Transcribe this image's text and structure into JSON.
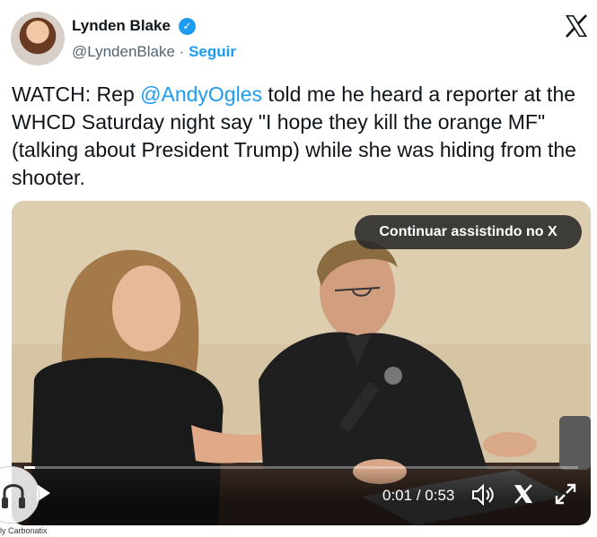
{
  "author": {
    "name": "Lynden Blake",
    "handle": "@LyndenBlake",
    "separator": "·",
    "follow_label": "Seguir",
    "verified_icon": "verified-badge-icon"
  },
  "header": {
    "logo_icon": "x-logo-icon"
  },
  "tweet": {
    "text_before": "WATCH: Rep ",
    "mention": "@AndyOgles",
    "text_after": " told me he heard a reporter at the WHCD Saturday night say \"I hope they kill the orange MF\" (talking about President Trump) while she was hiding from the shooter."
  },
  "video": {
    "continue_label": "Continuar assistindo no X",
    "time_current": "0:01",
    "time_separator": " / ",
    "time_total": "0:53",
    "progress_fraction": 0.02,
    "icons": [
      "play-icon",
      "volume-icon",
      "x-logo-icon",
      "fullscreen-icon"
    ]
  },
  "watermark": {
    "text": "ly Carbonatix",
    "icon": "headphones-icon"
  },
  "colors": {
    "link": "#1d9bf0",
    "text": "#0f1419",
    "muted": "#536471"
  }
}
